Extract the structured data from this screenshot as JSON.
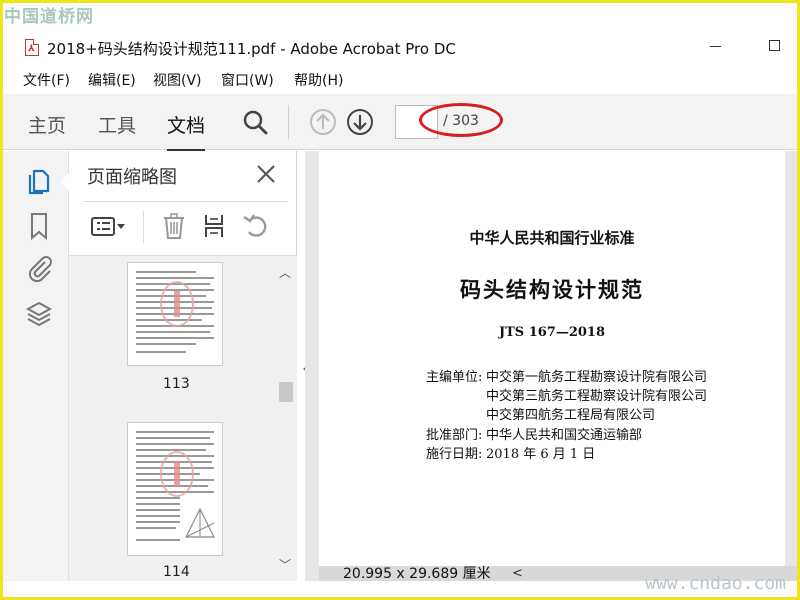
{
  "watermark": {
    "top": "中国道桥网",
    "bottom": "www.cndao.com"
  },
  "window": {
    "title": "2018+码头结构设计规范111.pdf - Adobe Acrobat Pro DC",
    "app_icon": "pdf-icon"
  },
  "menu": [
    "文件(F)",
    "编辑(E)",
    "视图(V)",
    "窗口(W)",
    "帮助(H)"
  ],
  "toolbar": {
    "tabs": [
      "主页",
      "工具",
      "文档"
    ],
    "active_tab": "文档",
    "page_value": "",
    "page_total": "/ 303"
  },
  "panel": {
    "title": "页面缩略图",
    "thumbnails": [
      {
        "label": "113"
      },
      {
        "label": "114"
      }
    ]
  },
  "document": {
    "standard": "中华人民共和国行业标准",
    "title": "码头结构设计规范",
    "code": "JTS 167—2018",
    "editor_label": "主编单位:",
    "editors": [
      "中交第一航务工程勘察设计院有限公司",
      "中交第三航务工程勘察设计院有限公司",
      "中交第四航务工程局有限公司"
    ],
    "approval_label": "批准部门:",
    "approval": "中华人民共和国交通运输部",
    "date_label": "施行日期:",
    "date": "2018 年 6 月 1 日"
  },
  "status": {
    "page_size": "20.995 x 29.689 厘米"
  },
  "colors": {
    "annotation_oval": "#d62020",
    "border": "#f0e51a",
    "pdf_icon": "#cc2222",
    "panel_icon": "#1f6fc2"
  }
}
